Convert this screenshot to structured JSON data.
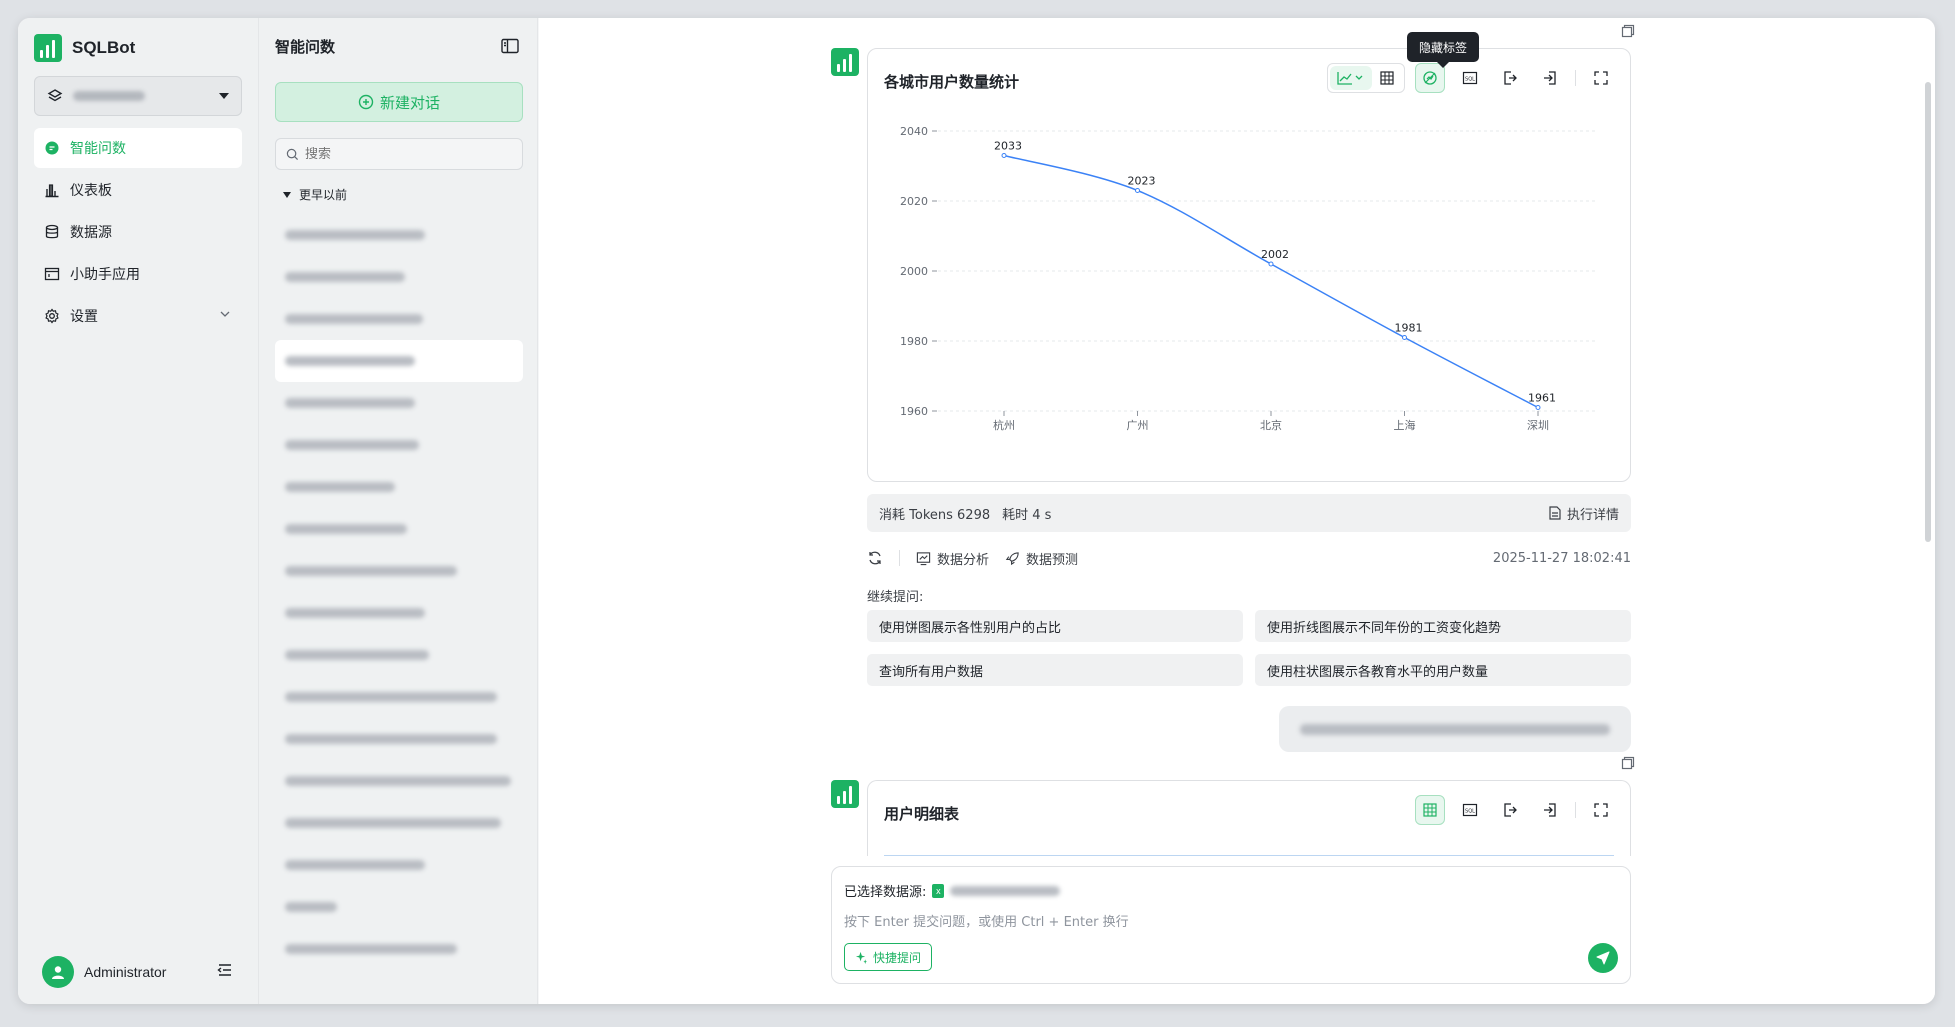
{
  "app": {
    "name": "SQLBot"
  },
  "sidebar": {
    "items": [
      {
        "label": "智能问数",
        "icon": "chat-icon",
        "active": true
      },
      {
        "label": "仪表板",
        "icon": "bar-chart-icon"
      },
      {
        "label": "数据源",
        "icon": "database-icon"
      },
      {
        "label": "小助手应用",
        "icon": "window-icon"
      },
      {
        "label": "设置",
        "icon": "gear-icon",
        "expandable": true
      }
    ],
    "user": "Administrator"
  },
  "history": {
    "title": "智能问数",
    "new_chat": "新建对话",
    "search_placeholder": "搜索",
    "group": "更早以前"
  },
  "chat": {
    "chart_card": {
      "title": "各城市用户数量统计",
      "tooltip": "隐藏标签"
    },
    "stats": {
      "tokens": "消耗 Tokens 6298",
      "time": "耗时 4 s",
      "detail": "执行详情"
    },
    "actions": {
      "analysis": "数据分析",
      "predict": "数据预测",
      "timestamp": "2025-11-27 18:02:41"
    },
    "followup_label": "继续提问:",
    "suggestions": [
      "使用饼图展示各性别用户的占比",
      "使用折线图展示不同年份的工资变化趋势",
      "查询所有用户数据",
      "使用柱状图展示各教育水平的用户数量"
    ],
    "table_card": {
      "title": "用户明细表"
    }
  },
  "input": {
    "ds_label": "已选择数据源:",
    "placeholder": "按下 Enter 提交问题，或使用 Ctrl + Enter 换行",
    "quick": "快捷提问"
  },
  "colors": {
    "brand": "#1db263",
    "line": "#3b82f6"
  },
  "chart_data": {
    "type": "line",
    "categories": [
      "杭州",
      "广州",
      "北京",
      "上海",
      "深圳"
    ],
    "values": [
      2033,
      2023,
      2002,
      1981,
      1961
    ],
    "ylim": [
      1960,
      2040
    ],
    "yticks": [
      1960,
      1980,
      2000,
      2020,
      2040
    ],
    "data_labels": true
  }
}
